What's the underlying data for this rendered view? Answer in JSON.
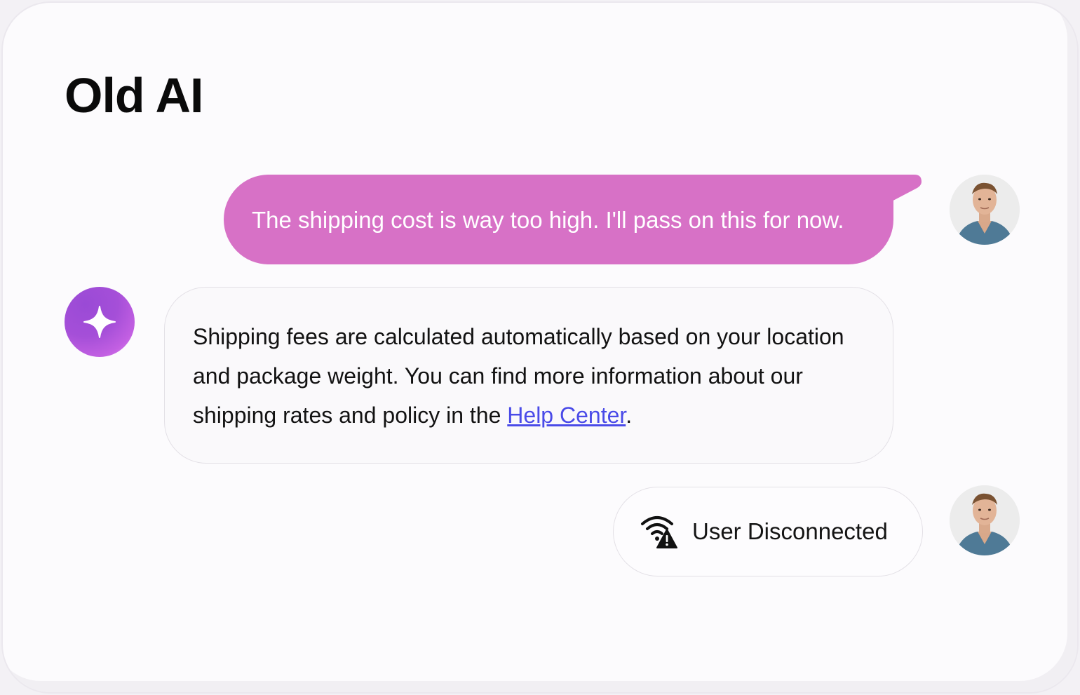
{
  "title": "Old AI",
  "messages": {
    "user_message": "The shipping cost is way too high. I'll pass on this for now.",
    "ai_message_before_link": "Shipping fees are calculated automatically based on your location and package weight. You can find more information about our shipping rates and policy in the ",
    "ai_message_link": "Help Center",
    "ai_message_after_link": "."
  },
  "status": {
    "label": "User Disconnected",
    "icon": "wifi-warning-icon"
  },
  "colors": {
    "user_bubble": "#d771c6",
    "ai_avatar": "#a54fd8",
    "link": "#4a4be8"
  },
  "icons": {
    "user_avatar": "user-avatar",
    "ai_avatar": "sparkle-icon"
  }
}
